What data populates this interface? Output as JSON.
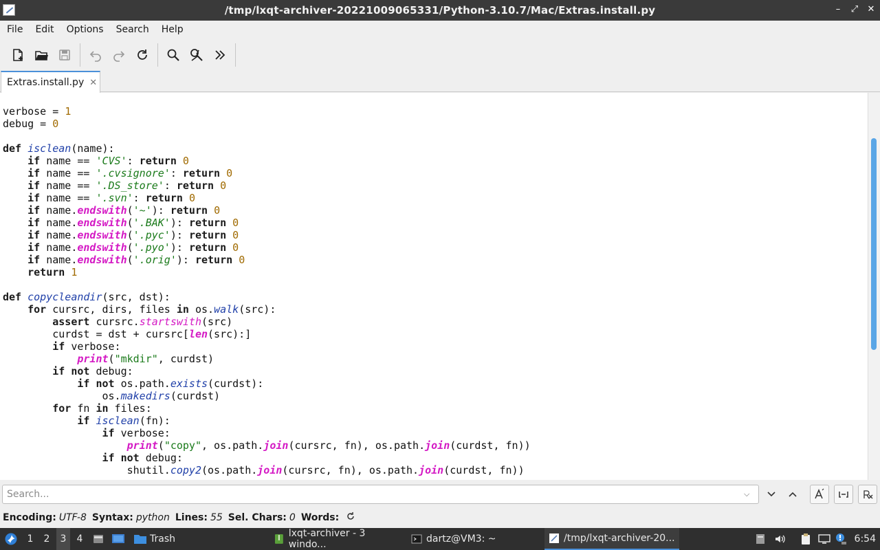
{
  "window": {
    "title": "/tmp/lxqt-archiver-20221009065331/Python-3.10.7/Mac/Extras.install.py",
    "controls": [
      "–",
      "⤢",
      "✕"
    ]
  },
  "menu": [
    "File",
    "Edit",
    "Options",
    "Search",
    "Help"
  ],
  "tabs": [
    {
      "label": "Extras.install.py",
      "close": "✕"
    }
  ],
  "search": {
    "placeholder": "Search..."
  },
  "status": {
    "encoding_label": "Encoding:",
    "encoding": "UTF-8",
    "syntax_label": "Syntax:",
    "syntax": "python",
    "lines_label": "Lines:",
    "lines": "55",
    "sel_label": "Sel. Chars:",
    "sel": "0",
    "words_label": "Words:"
  },
  "taskbar": {
    "desktops": [
      "1",
      "2",
      "3",
      "4"
    ],
    "active_desktop": "3",
    "trash": "Trash",
    "tasks": [
      {
        "label": "lxqt-archiver - 3 windo..."
      },
      {
        "label": "dartz@VM3: ~"
      },
      {
        "label": "/tmp/lxqt-archiver-20..."
      }
    ],
    "clock": "6:54"
  },
  "colors": {
    "titlebar": "#3a3a3a",
    "accent": "#4a90d9",
    "keyword_builtin": "#d419c4",
    "number": "#a06a00",
    "string": "#1a7a1a",
    "function": "#1f3fa8"
  },
  "code": [
    [
      [
        "t",
        "verbose = "
      ],
      [
        "num",
        "1"
      ]
    ],
    [
      [
        "t",
        "debug = "
      ],
      [
        "num",
        "0"
      ]
    ],
    [],
    [
      [
        "kw",
        "def "
      ],
      [
        "fn",
        "isclean"
      ],
      [
        "t",
        "(name):"
      ]
    ],
    [
      [
        "t",
        "    "
      ],
      [
        "kw",
        "if"
      ],
      [
        "t",
        " name == "
      ],
      [
        "str",
        "'CVS'"
      ],
      [
        "t",
        ": "
      ],
      [
        "kw",
        "return"
      ],
      [
        "t",
        " "
      ],
      [
        "num",
        "0"
      ]
    ],
    [
      [
        "t",
        "    "
      ],
      [
        "kw",
        "if"
      ],
      [
        "t",
        " name == "
      ],
      [
        "str",
        "'.cvsignore'"
      ],
      [
        "t",
        ": "
      ],
      [
        "kw",
        "return"
      ],
      [
        "t",
        " "
      ],
      [
        "num",
        "0"
      ]
    ],
    [
      [
        "t",
        "    "
      ],
      [
        "kw",
        "if"
      ],
      [
        "t",
        " name == "
      ],
      [
        "str",
        "'.DS_store'"
      ],
      [
        "t",
        ": "
      ],
      [
        "kw",
        "return"
      ],
      [
        "t",
        " "
      ],
      [
        "num",
        "0"
      ]
    ],
    [
      [
        "t",
        "    "
      ],
      [
        "kw",
        "if"
      ],
      [
        "t",
        " name == "
      ],
      [
        "str",
        "'.svn'"
      ],
      [
        "t",
        ": "
      ],
      [
        "kw",
        "return"
      ],
      [
        "t",
        " "
      ],
      [
        "num",
        "0"
      ]
    ],
    [
      [
        "t",
        "    "
      ],
      [
        "kw",
        "if"
      ],
      [
        "t",
        " name."
      ],
      [
        "bi",
        "endswith"
      ],
      [
        "t",
        "("
      ],
      [
        "str",
        "'~'"
      ],
      [
        "t",
        "): "
      ],
      [
        "kw",
        "return"
      ],
      [
        "t",
        " "
      ],
      [
        "num",
        "0"
      ]
    ],
    [
      [
        "t",
        "    "
      ],
      [
        "kw",
        "if"
      ],
      [
        "t",
        " name."
      ],
      [
        "bi",
        "endswith"
      ],
      [
        "t",
        "("
      ],
      [
        "str",
        "'.BAK'"
      ],
      [
        "t",
        "): "
      ],
      [
        "kw",
        "return"
      ],
      [
        "t",
        " "
      ],
      [
        "num",
        "0"
      ]
    ],
    [
      [
        "t",
        "    "
      ],
      [
        "kw",
        "if"
      ],
      [
        "t",
        " name."
      ],
      [
        "bi",
        "endswith"
      ],
      [
        "t",
        "("
      ],
      [
        "str",
        "'.pyc'"
      ],
      [
        "t",
        "): "
      ],
      [
        "kw",
        "return"
      ],
      [
        "t",
        " "
      ],
      [
        "num",
        "0"
      ]
    ],
    [
      [
        "t",
        "    "
      ],
      [
        "kw",
        "if"
      ],
      [
        "t",
        " name."
      ],
      [
        "bi",
        "endswith"
      ],
      [
        "t",
        "("
      ],
      [
        "str",
        "'.pyo'"
      ],
      [
        "t",
        "): "
      ],
      [
        "kw",
        "return"
      ],
      [
        "t",
        " "
      ],
      [
        "num",
        "0"
      ]
    ],
    [
      [
        "t",
        "    "
      ],
      [
        "kw",
        "if"
      ],
      [
        "t",
        " name."
      ],
      [
        "bi",
        "endswith"
      ],
      [
        "t",
        "("
      ],
      [
        "str",
        "'.orig'"
      ],
      [
        "t",
        "): "
      ],
      [
        "kw",
        "return"
      ],
      [
        "t",
        " "
      ],
      [
        "num",
        "0"
      ]
    ],
    [
      [
        "t",
        "    "
      ],
      [
        "kw",
        "return"
      ],
      [
        "t",
        " "
      ],
      [
        "num",
        "1"
      ]
    ],
    [],
    [
      [
        "kw",
        "def "
      ],
      [
        "fn",
        "copycleandir"
      ],
      [
        "t",
        "(src, dst):"
      ]
    ],
    [
      [
        "t",
        "    "
      ],
      [
        "kw",
        "for"
      ],
      [
        "t",
        " cursrc, dirs, files "
      ],
      [
        "kw",
        "in"
      ],
      [
        "t",
        " os."
      ],
      [
        "attr",
        "walk"
      ],
      [
        "t",
        "(src):"
      ]
    ],
    [
      [
        "t",
        "        "
      ],
      [
        "kw",
        "assert"
      ],
      [
        "t",
        " cursrc."
      ],
      [
        "mth",
        "startswith"
      ],
      [
        "t",
        "(src)"
      ]
    ],
    [
      [
        "t",
        "        curdst = dst + cursrc["
      ],
      [
        "bi",
        "len"
      ],
      [
        "t",
        "(src):]"
      ]
    ],
    [
      [
        "t",
        "        "
      ],
      [
        "kw",
        "if"
      ],
      [
        "t",
        " verbose:"
      ]
    ],
    [
      [
        "t",
        "            "
      ],
      [
        "bi",
        "print"
      ],
      [
        "t",
        "("
      ],
      [
        "dstr",
        "\"mkdir\""
      ],
      [
        "t",
        ", curdst)"
      ]
    ],
    [
      [
        "t",
        "        "
      ],
      [
        "kw",
        "if"
      ],
      [
        "t",
        " "
      ],
      [
        "kw",
        "not"
      ],
      [
        "t",
        " debug:"
      ]
    ],
    [
      [
        "t",
        "            "
      ],
      [
        "kw",
        "if"
      ],
      [
        "t",
        " "
      ],
      [
        "kw",
        "not"
      ],
      [
        "t",
        " os.path."
      ],
      [
        "attr",
        "exists"
      ],
      [
        "t",
        "(curdst):"
      ]
    ],
    [
      [
        "t",
        "                os."
      ],
      [
        "attr",
        "makedirs"
      ],
      [
        "t",
        "(curdst)"
      ]
    ],
    [
      [
        "t",
        "        "
      ],
      [
        "kw",
        "for"
      ],
      [
        "t",
        " fn "
      ],
      [
        "kw",
        "in"
      ],
      [
        "t",
        " files:"
      ]
    ],
    [
      [
        "t",
        "            "
      ],
      [
        "kw",
        "if"
      ],
      [
        "t",
        " "
      ],
      [
        "fn",
        "isclean"
      ],
      [
        "t",
        "(fn):"
      ]
    ],
    [
      [
        "t",
        "                "
      ],
      [
        "kw",
        "if"
      ],
      [
        "t",
        " verbose:"
      ]
    ],
    [
      [
        "t",
        "                    "
      ],
      [
        "bi",
        "print"
      ],
      [
        "t",
        "("
      ],
      [
        "dstr",
        "\"copy\""
      ],
      [
        "t",
        ", os.path."
      ],
      [
        "bi",
        "join"
      ],
      [
        "t",
        "(cursrc, fn), os.path."
      ],
      [
        "bi",
        "join"
      ],
      [
        "t",
        "(curdst, fn))"
      ]
    ],
    [
      [
        "t",
        "                "
      ],
      [
        "kw",
        "if"
      ],
      [
        "t",
        " "
      ],
      [
        "kw",
        "not"
      ],
      [
        "t",
        " debug:"
      ]
    ],
    [
      [
        "t",
        "                    shutil."
      ],
      [
        "attr",
        "copy2"
      ],
      [
        "t",
        "(os.path."
      ],
      [
        "bi",
        "join"
      ],
      [
        "t",
        "(cursrc, fn), os.path."
      ],
      [
        "bi",
        "join"
      ],
      [
        "t",
        "(curdst, fn))"
      ]
    ]
  ]
}
